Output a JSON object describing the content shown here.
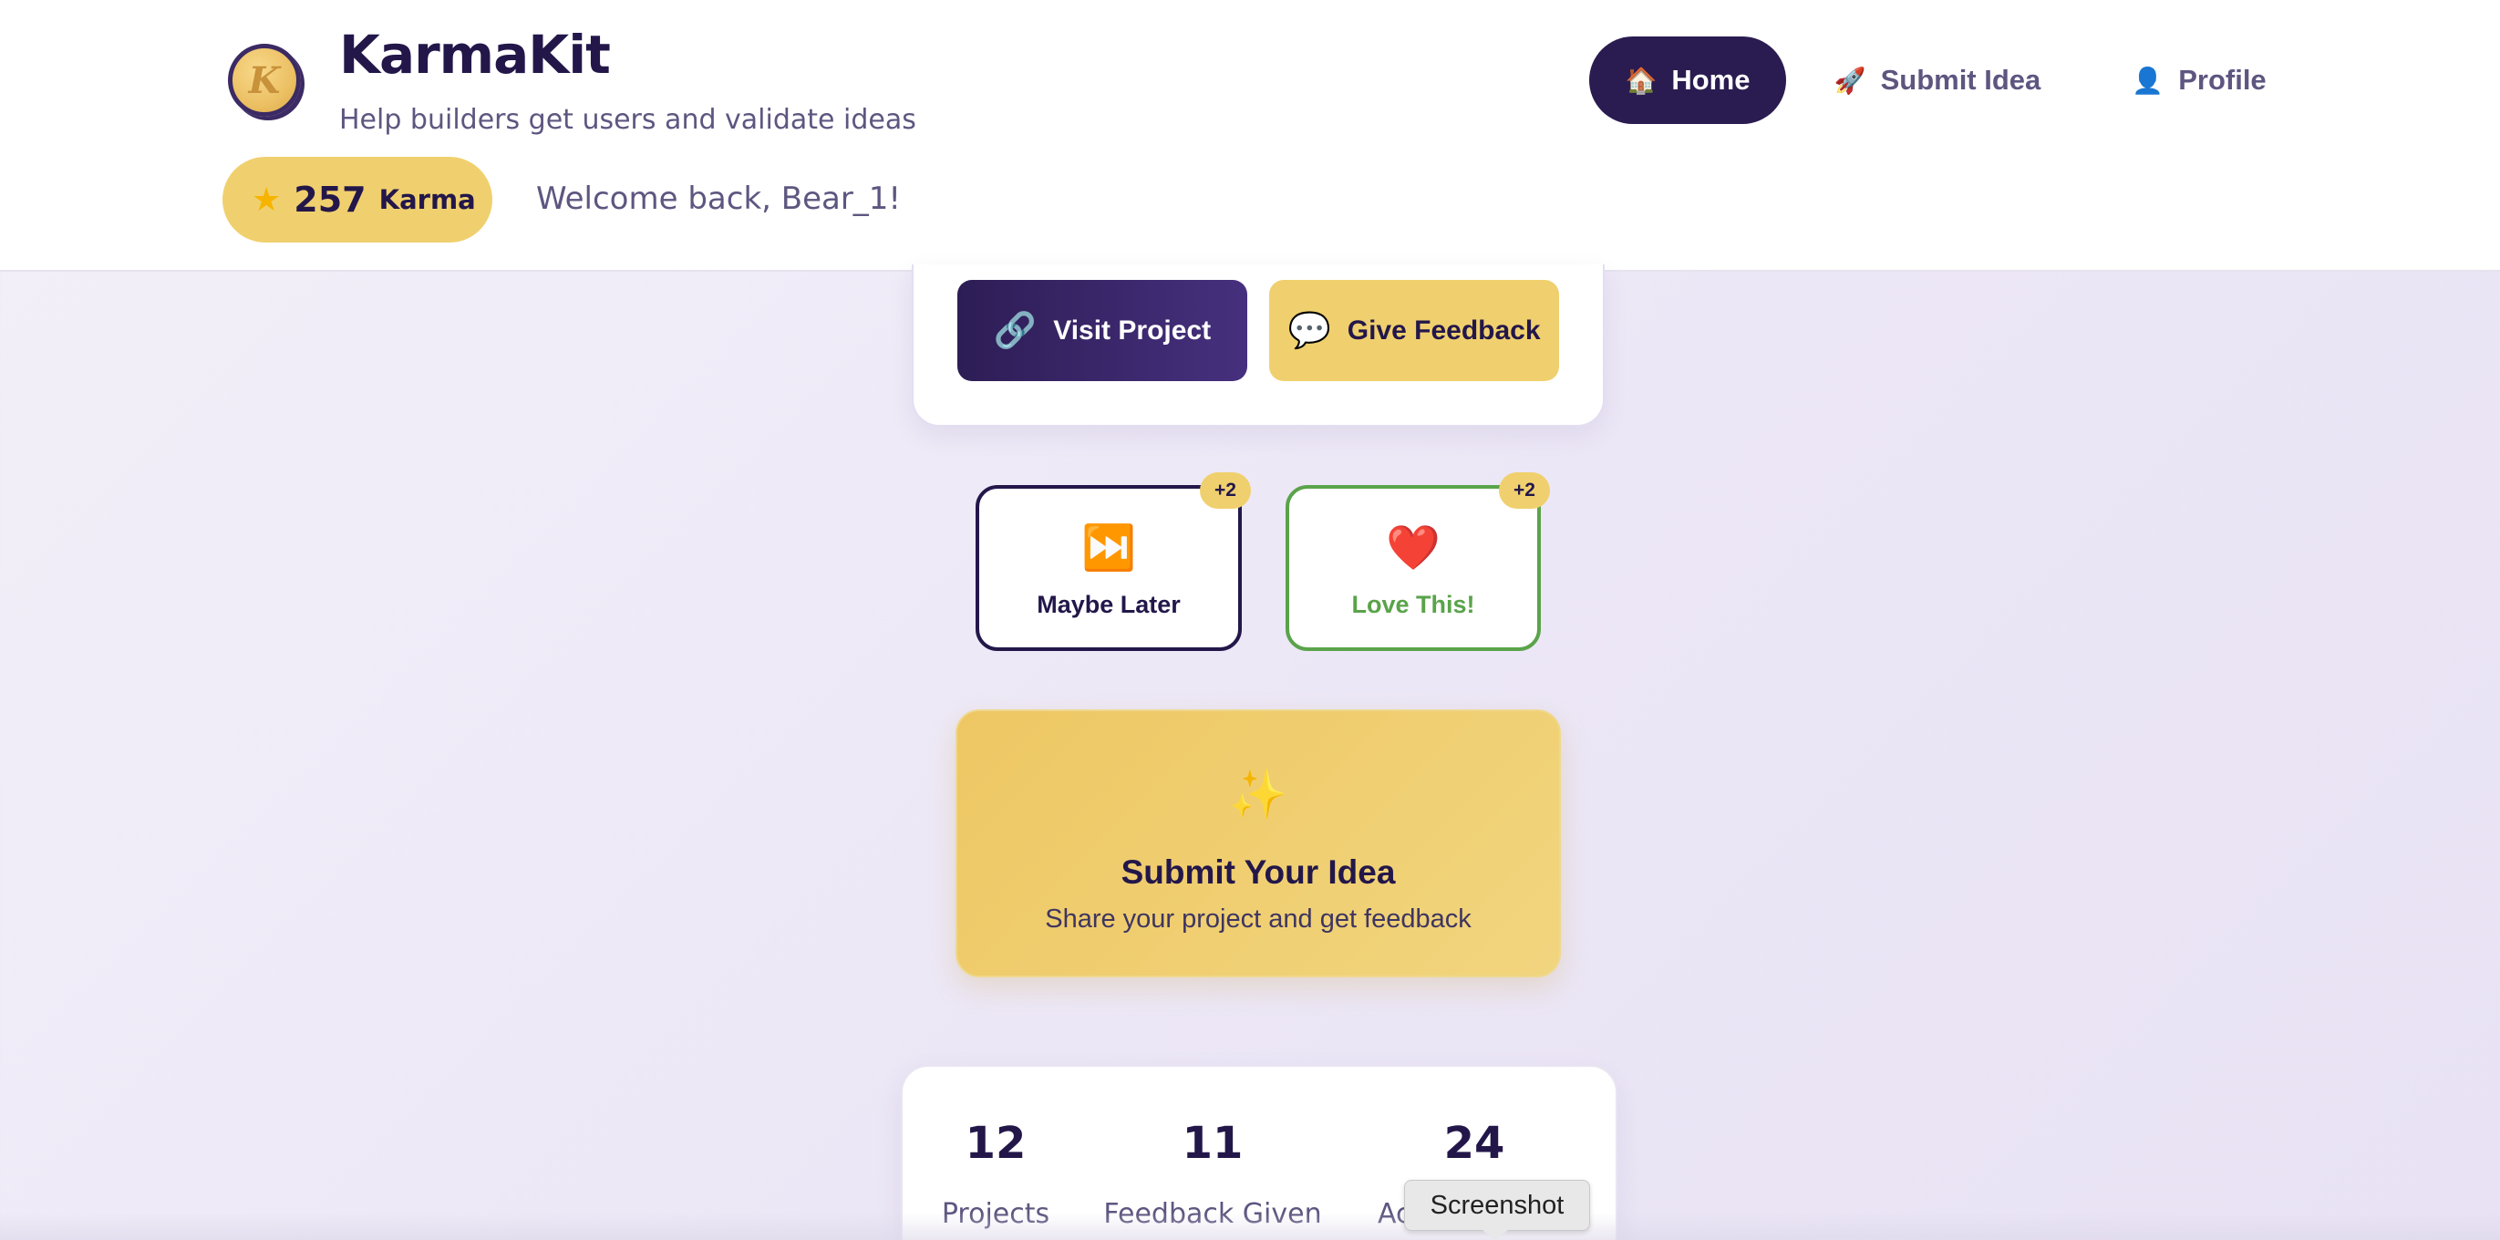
{
  "header": {
    "logo_letter": "K",
    "title": "KarmaKit",
    "tagline": "Help builders get users and validate ideas",
    "karma": {
      "star_icon": "star-icon",
      "value": "257",
      "label": "Karma"
    },
    "welcome": "Welcome back, Bear_1!"
  },
  "nav": {
    "home": {
      "icon": "🏠",
      "label": "Home",
      "active": true
    },
    "submit": {
      "icon": "🚀",
      "label": "Submit Idea"
    },
    "profile": {
      "icon": "👤",
      "label": "Profile"
    }
  },
  "project_actions": {
    "visit": {
      "icon": "🔗",
      "label": "Visit Project"
    },
    "feedback": {
      "icon": "💬",
      "label": "Give Feedback"
    }
  },
  "votes": {
    "later": {
      "icon": "⏭️",
      "label": "Maybe Later",
      "badge": "+2"
    },
    "love": {
      "icon": "❤️",
      "label": "Love This!",
      "badge": "+2"
    }
  },
  "submit_card": {
    "icon": "✨",
    "title": "Submit Your Idea",
    "subtitle": "Share your project and get feedback"
  },
  "stats": [
    {
      "value": "12",
      "label": "Projects"
    },
    {
      "value": "11",
      "label": "Feedback Given"
    },
    {
      "value": "24",
      "label": "Ac"
    }
  ],
  "tooltip": "Screenshot",
  "colors": {
    "primary": "#2a1c50",
    "accent_yellow": "#f0d06e",
    "love_green": "#5aa34a",
    "text_muted": "#5e5680"
  }
}
